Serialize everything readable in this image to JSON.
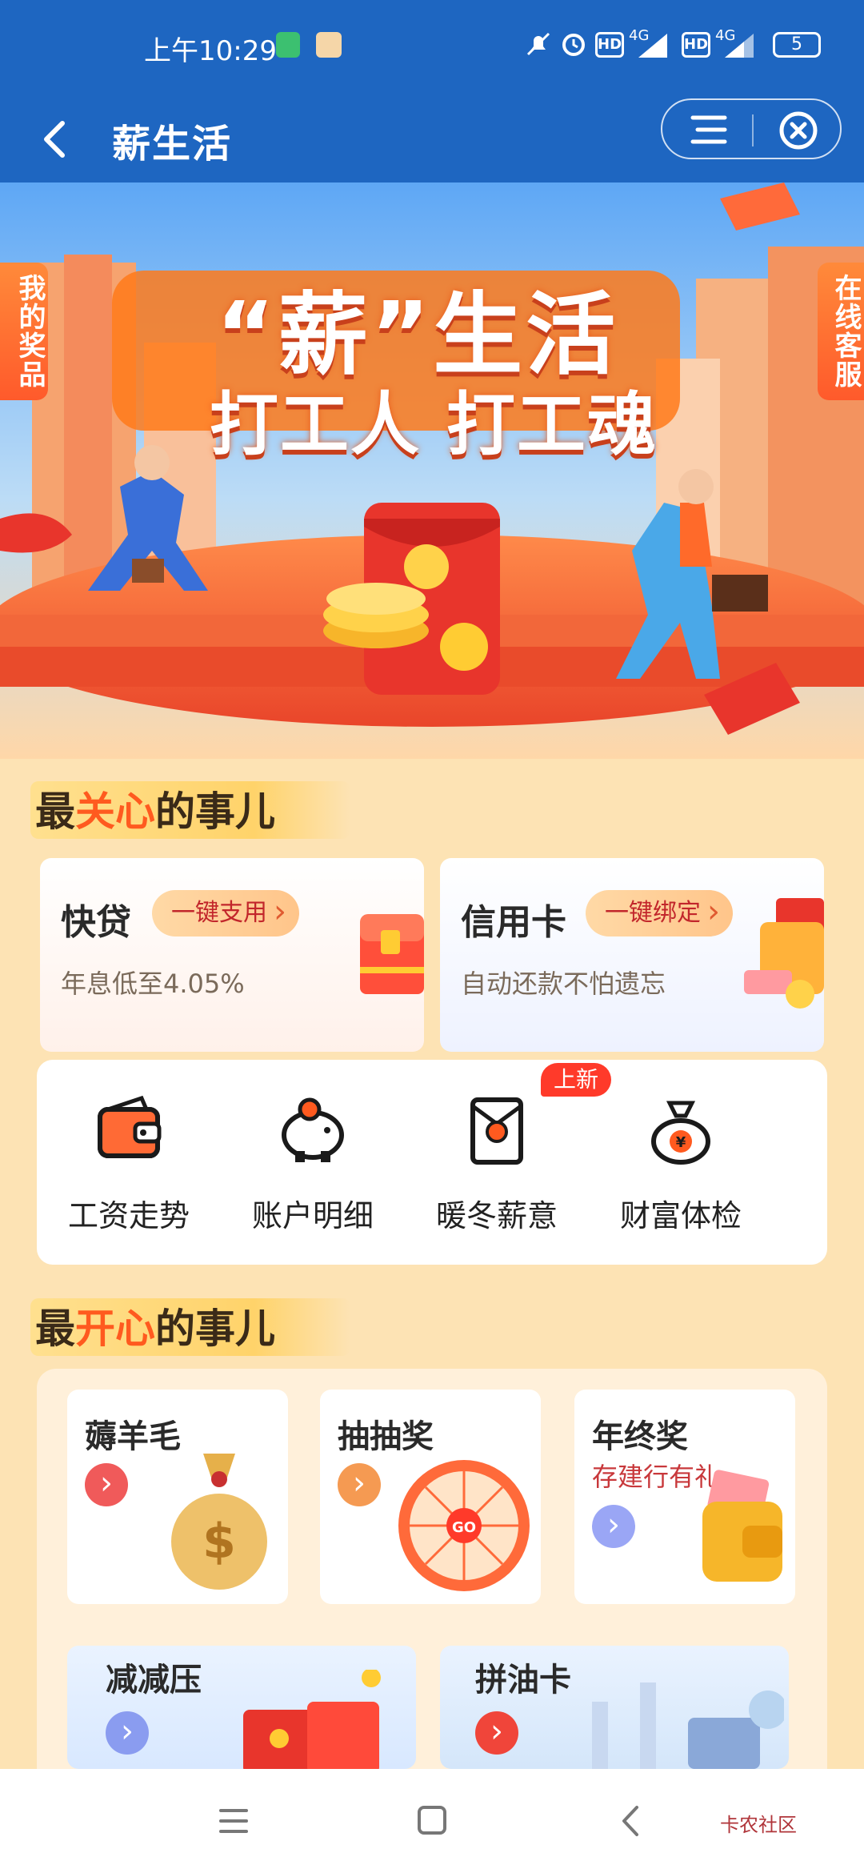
{
  "status_bar": {
    "time": "上午10:29",
    "network1": "4G",
    "network2": "4G",
    "battery": "5"
  },
  "nav": {
    "title": "薪生活"
  },
  "banner": {
    "title_line1": "“薪”生活",
    "title_line2": "打工人 打工魂",
    "left_tag": "我的奖品",
    "right_tag": "在线客服"
  },
  "section1": {
    "prefix": "最",
    "highlight": "关心",
    "suffix": "的事儿"
  },
  "loan_card": {
    "title": "快贷",
    "button": "一键支用",
    "subtitle": "年息低至4.05%"
  },
  "credit_card": {
    "title": "信用卡",
    "button": "一键绑定",
    "subtitle": "自动还款不怕遗忘"
  },
  "quick_items": [
    {
      "label": "工资走势",
      "icon": "wallet-icon"
    },
    {
      "label": "账户明细",
      "icon": "piggy-bank-icon"
    },
    {
      "label": "暖冬薪意",
      "icon": "red-envelope-icon"
    },
    {
      "label": "财富体检",
      "icon": "money-bag-icon"
    }
  ],
  "new_badge": "上新",
  "section2": {
    "prefix": "最",
    "highlight": "开心",
    "suffix": "的事儿"
  },
  "tiles": [
    {
      "title": "薅羊毛",
      "subtitle": ""
    },
    {
      "title": "抽抽奖",
      "subtitle": "",
      "wheel_text": "GO"
    },
    {
      "title": "年终奖",
      "subtitle": "存建行有礼"
    },
    {
      "title": "减减压",
      "subtitle": ""
    },
    {
      "title": "拼油卡",
      "subtitle": ""
    }
  ],
  "watermark": "卡农社区",
  "colors": {
    "nav_blue": "#1e66c1",
    "accent_orange": "#ff5a1f",
    "page_bg": "#fde3b4"
  }
}
